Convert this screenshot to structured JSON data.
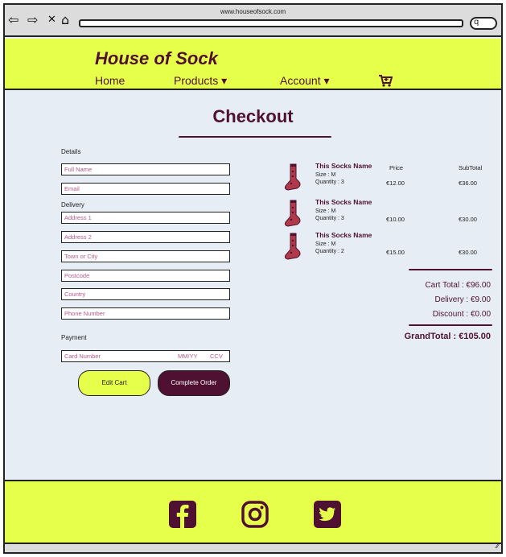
{
  "browser": {
    "url": "www.houseofsock.com",
    "back_icon": "⇦",
    "forward_icon": "⇨",
    "close_icon": "✕",
    "home_icon": "⌂",
    "search_icon": "q"
  },
  "header": {
    "brand": "House of Sock",
    "nav": [
      {
        "label": "Home"
      },
      {
        "label": "Products ▾"
      },
      {
        "label": "Account ▾"
      }
    ],
    "cart_icon": "🛒"
  },
  "checkout": {
    "title": "Checkout",
    "details_label": "Details",
    "delivery_label": "Delivery",
    "payment_label": "Payment",
    "fields": {
      "full_name": "Full Name",
      "email": "Email",
      "address1": "Address 1",
      "address2": "Address 2",
      "town": "Town or City",
      "postcode": "Postcode",
      "country": "Country",
      "phone": "Phone Number",
      "card_number": "Card Number",
      "mmyy": "MM/YY",
      "ccv": "CCV"
    },
    "buttons": {
      "edit_cart": "Edit Cart",
      "complete_order": "Complete Order"
    }
  },
  "order": {
    "price_header": "Price",
    "subtotal_header": "SubTotal",
    "items": [
      {
        "name": "This Socks Name",
        "size": "Size : M",
        "quantity": "Quantity : 3",
        "price": "€12.00",
        "subtotal": "€36.00"
      },
      {
        "name": "This Socks Name",
        "size": "Size : M",
        "quantity": "Quantity : 3",
        "price": "€10.00",
        "subtotal": "€30.00"
      },
      {
        "name": "This Socks Name",
        "size": "Size : M",
        "quantity": "Quantity : 2",
        "price": "€15.00",
        "subtotal": "€30.00"
      }
    ],
    "cart_total": "Cart Total : €96.00",
    "delivery": "Delivery :   €9.00",
    "discount": "Discount :   €0.00",
    "grand_total": "GrandTotal : €105.00"
  },
  "footer": {
    "social": [
      "facebook-icon",
      "instagram-icon",
      "twitter-icon"
    ]
  },
  "colors": {
    "accent": "#e6ff4a",
    "brand": "#4f1131",
    "background": "#e6edf5"
  }
}
